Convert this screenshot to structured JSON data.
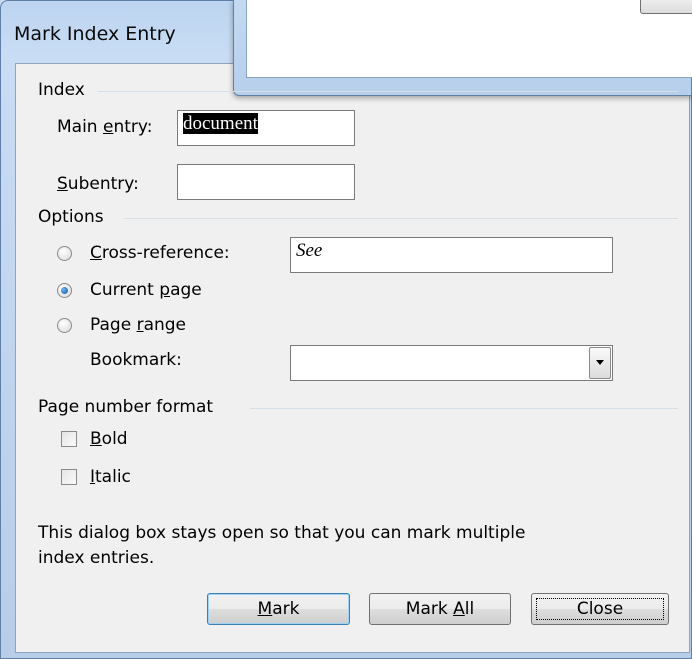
{
  "window": {
    "title": "Mark Index Entry"
  },
  "index": {
    "heading": "Index",
    "main_entry_label_pre": "Main ",
    "main_entry_label_mnemonic": "e",
    "main_entry_label_post": "ntry:",
    "main_entry_value": "document",
    "subentry_label_mnemonic": "S",
    "subentry_label_post": "ubentry:",
    "subentry_value": ""
  },
  "options": {
    "heading": "Options",
    "cross_reference": {
      "mnemonic": "C",
      "rest": "ross-reference:",
      "selected": false,
      "value": "See"
    },
    "current_page": {
      "pre": "Current ",
      "mnemonic": "p",
      "post": "age",
      "selected": true
    },
    "page_range": {
      "pre": "Page ",
      "mnemonic": "r",
      "post": "ange",
      "selected": false
    },
    "bookmark_label": "Bookmark:",
    "bookmark_value": ""
  },
  "page_number_format": {
    "heading": "Page number format",
    "bold": {
      "mnemonic": "B",
      "rest": "old",
      "checked": false
    },
    "italic": {
      "mnemonic": "I",
      "rest": "talic",
      "checked": false
    }
  },
  "info_text_line1": "This dialog box stays open so that you can mark multiple",
  "info_text_line2": "index entries.",
  "buttons": {
    "mark": {
      "mnemonic": "M",
      "rest": "ark"
    },
    "mark_all": {
      "pre": "Mark ",
      "mnemonic": "A",
      "rest": "ll"
    },
    "close": {
      "label": "Close"
    }
  },
  "colors": {
    "frame": "#c8dcf4",
    "client": "#f0f0f0",
    "accent": "#3c7fb1"
  }
}
